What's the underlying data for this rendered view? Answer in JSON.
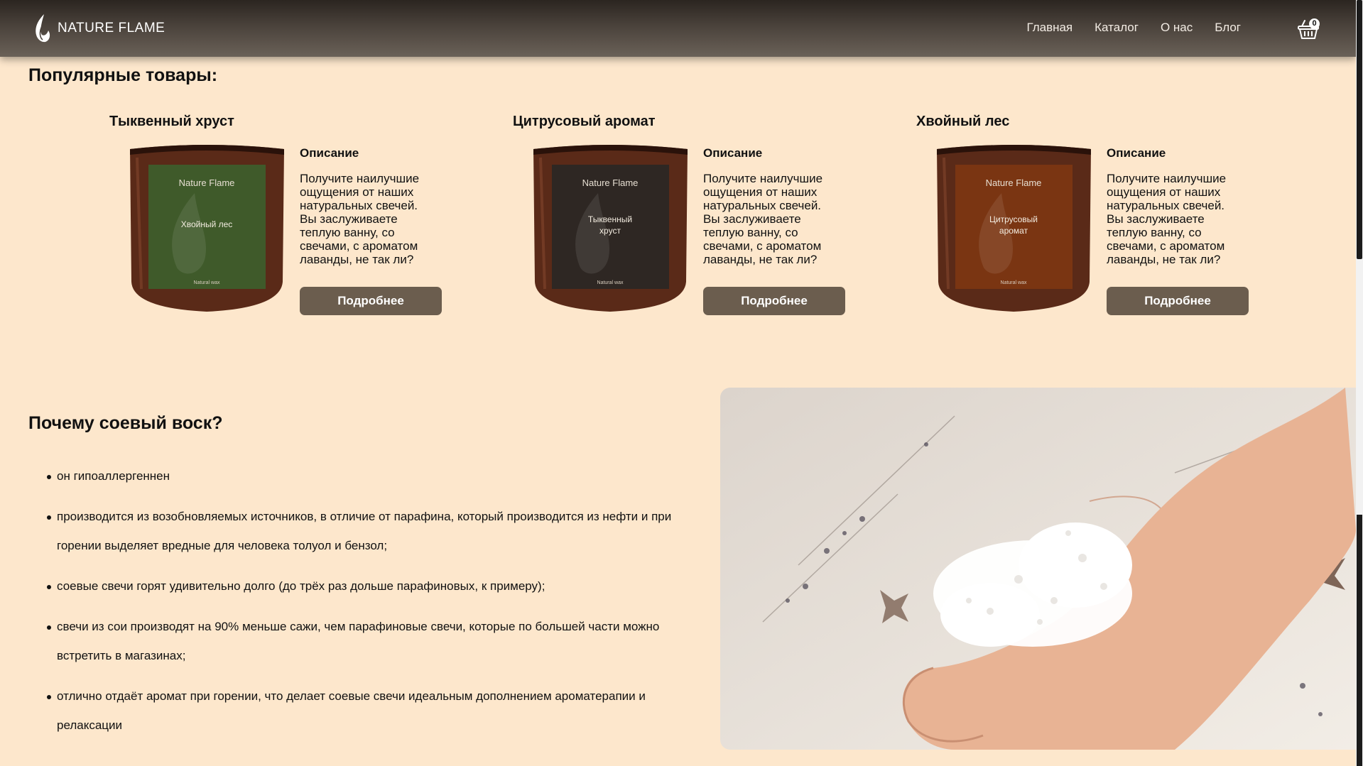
{
  "brand": {
    "name": "NATURE FLAME"
  },
  "nav": {
    "items": [
      "Главная",
      "Каталог",
      "О нас",
      "Блог"
    ]
  },
  "cart": {
    "count": "0"
  },
  "popular": {
    "title": "Популярные товары:",
    "products": [
      {
        "name": "Тыквенный хруст",
        "label_brand": "Nature Flame",
        "label_name": "Хвойный лес",
        "label_foot": "Natural wax",
        "label_color": "#3f5a2a",
        "desc_title": "Описание",
        "desc_text": "Получите наилучшие ощущения от наших натуральных свечей. Вы заслуживаете теплую ванну, со свечами, с ароматом лаванды, не так ли?",
        "button": "Подробнее"
      },
      {
        "name": "Цитрусовый аромат",
        "label_brand": "Nature Flame",
        "label_name": "Тыквенный хруст",
        "label_foot": "Natural wax",
        "label_color": "#2e2723",
        "desc_title": "Описание",
        "desc_text": "Получите наилучшие ощущения от наших натуральных свечей. Вы заслуживаете теплую ванну, со свечами, с ароматом лаванды, не так ли?",
        "button": "Подробнее"
      },
      {
        "name": "Хвойный лес",
        "label_brand": "Nature Flame",
        "label_name": "Цитрусовый аромат",
        "label_foot": "Natural wax",
        "label_color": "#7a3512",
        "desc_title": "Описание",
        "desc_text": "Получите наилучшие ощущения от наших натуральных свечей. Вы заслуживаете теплую ванну, со свечами, с ароматом лаванды, не так ли?",
        "button": "Подробнее"
      }
    ]
  },
  "soy": {
    "title": "Почему соевый воск?",
    "items": [
      "он гипоаллергеннен",
      "производится из возобновляемых источников, в отличие от парафина, который производится из нефти и при горении выделяет вредные для человека толуол и бензол;",
      "соевые свечи горят удивительно долго (до трёх раз дольше парафиновых, к примеру);",
      "свечи из сои производят на 90% меньше сажи, чем парафиновые свечи, которые по большей части можно встретить в магазинах;",
      "отлично отдаёт аромат при горении, что делает соевые свечи идеальным дополнением ароматерапии и релаксации"
    ]
  },
  "colors": {
    "background": "#fde7cc",
    "button": "#6b5d4e",
    "header": "#4a423b"
  }
}
